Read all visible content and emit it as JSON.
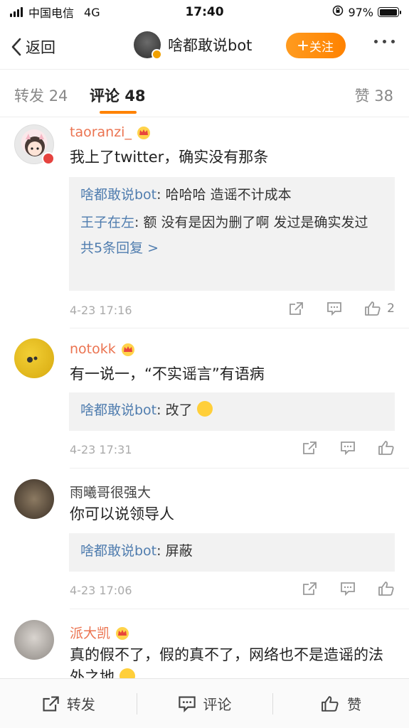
{
  "status_bar": {
    "carrier": "中国电信",
    "network": "4G",
    "time": "17:40",
    "battery_percent": "97%",
    "battery_level": 0.97
  },
  "nav": {
    "back_label": "返回",
    "account_name": "啥都敢说bot",
    "follow_label": "关注"
  },
  "tabs": [
    {
      "label": "转发",
      "count": "24"
    },
    {
      "label": "评论",
      "count": "48"
    },
    {
      "label": "赞",
      "count": "38"
    }
  ],
  "comments": [
    {
      "username": "taoranzi_",
      "text": "我上了twitter，确实没有那条",
      "replies": [
        {
          "name": "啥都敢说bot",
          "text": ": 哈哈哈 造谣不计成本"
        },
        {
          "name": "王子在左",
          "text": ": 额 没有是因为删了啊 发过是确实发过"
        }
      ],
      "more_replies": "共5条回复 >",
      "time": "4-23 17:16",
      "likes": "2"
    },
    {
      "username": "notokk",
      "text": "有一说一，“不实谣言”有语病",
      "replies": [
        {
          "name": "啥都敢说bot",
          "text": ": 改了"
        }
      ],
      "time": "4-23 17:31",
      "likes": ""
    },
    {
      "username": "雨曦哥很强大",
      "text": "你可以说领导人",
      "replies": [
        {
          "name": "啥都敢说bot",
          "text": ": 屏蔽"
        }
      ],
      "time": "4-23 17:06",
      "likes": ""
    },
    {
      "username": "派大凯",
      "text": "真的假不了，假的真不了，网络也不是造谣的法外之地",
      "time": ""
    }
  ],
  "bottom_bar": {
    "repost_label": "转发",
    "comment_label": "评论",
    "like_label": "赞"
  },
  "colors": {
    "accent": "#ff8200",
    "username_orange": "#eb7350",
    "reply_blue": "#507daf"
  }
}
